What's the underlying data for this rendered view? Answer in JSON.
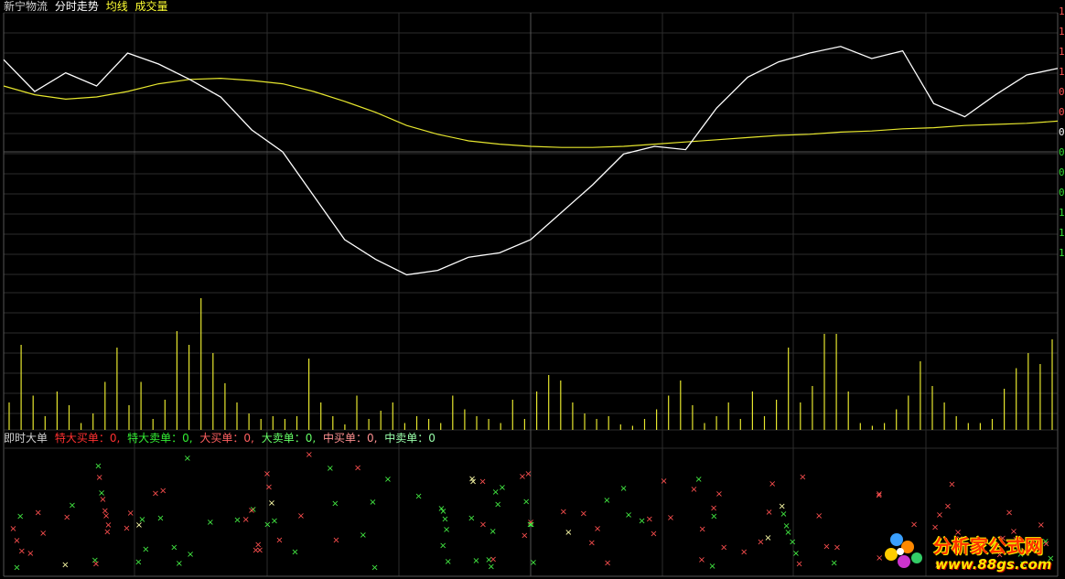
{
  "header": {
    "stock_name": "新宁物流",
    "view_title": "分时走势",
    "avg_label": "均线",
    "volume_label": "成交量"
  },
  "big_order_panel": {
    "title": "即时大单",
    "items": [
      {
        "label": "特大买单：0,",
        "color": "#ff3030"
      },
      {
        "label": "特大卖单：0,",
        "color": "#33ee33"
      },
      {
        "label": "大买单：0,",
        "color": "#ff6060"
      },
      {
        "label": "大卖单：0,",
        "color": "#66ff66"
      },
      {
        "label": "中买单：0,",
        "color": "#ff9090"
      },
      {
        "label": "中卖单：0",
        "color": "#99ffaa"
      }
    ]
  },
  "right_axis": {
    "labels": [
      "1",
      "1",
      "1",
      "1",
      "0",
      "0",
      "0",
      "0",
      "0",
      "0",
      "1",
      "1",
      "1"
    ],
    "label_colors": [
      "#ff5555",
      "#ff5555",
      "#ff5555",
      "#ff5555",
      "#ff5555",
      "#ff5555",
      "#ffffff",
      "#33dd33",
      "#33dd33",
      "#33dd33",
      "#33dd33",
      "#33dd33",
      "#33dd33"
    ]
  },
  "colors": {
    "price_line": "#ffffff",
    "avg_line": "#e6e62e",
    "volume_bar": "#e6e62e",
    "grid": "#2c2c2c",
    "buy_marker": "#ff5050",
    "sell_marker": "#44ee44",
    "big_marker": "#ffffaa"
  },
  "logo": {
    "text": "分析家公式网",
    "url": "www.88gs.com"
  },
  "chart_data": [
    {
      "type": "line",
      "title": "",
      "series": [
        {
          "name": "均线",
          "values": [
            0.6,
            0.52,
            0.48,
            0.5,
            0.55,
            0.62,
            0.66,
            0.67,
            0.65,
            0.62,
            0.55,
            0.46,
            0.36,
            0.24,
            0.16,
            0.1,
            0.07,
            0.05,
            0.04,
            0.04,
            0.05,
            0.07,
            0.09,
            0.11,
            0.13,
            0.15,
            0.16,
            0.18,
            0.19,
            0.21,
            0.22,
            0.24,
            0.25,
            0.26,
            0.28
          ]
        },
        {
          "name": "",
          "values": [
            0.84,
            0.55,
            0.72,
            0.6,
            0.9,
            0.8,
            0.66,
            0.5,
            0.2,
            0.0,
            -0.4,
            -0.8,
            -0.98,
            -1.12,
            -1.08,
            -0.96,
            -0.92,
            -0.8,
            -0.55,
            -0.3,
            -0.02,
            0.05,
            0.02,
            0.4,
            0.68,
            0.82,
            0.9,
            0.96,
            0.85,
            0.92,
            0.44,
            0.32,
            0.52,
            0.7,
            0.76
          ]
        }
      ]
    },
    {
      "type": "bar",
      "title": "",
      "values": [
        0.2,
        0.62,
        0.25,
        0.1,
        0.28,
        0.18,
        0.05,
        0.12,
        0.35,
        0.6,
        0.18,
        0.35,
        0.08,
        0.22,
        0.72,
        0.62,
        0.96,
        0.56,
        0.34,
        0.2,
        0.12,
        0.08,
        0.1,
        0.08,
        0.1,
        0.52,
        0.2,
        0.1,
        0.04,
        0.25,
        0.08,
        0.14,
        0.2,
        0.05,
        0.1,
        0.08,
        0.05,
        0.25,
        0.15,
        0.1,
        0.08,
        0.05,
        0.22,
        0.08,
        0.28,
        0.4,
        0.36,
        0.2,
        0.12,
        0.08,
        0.1,
        0.04,
        0.03,
        0.08,
        0.15,
        0.25,
        0.36,
        0.18,
        0.05,
        0.1,
        0.2,
        0.08,
        0.28,
        0.1,
        0.22,
        0.6,
        0.2,
        0.32,
        0.7,
        0.7,
        0.28,
        0.05,
        0.03,
        0.05,
        0.15,
        0.25,
        0.5,
        0.32,
        0.2,
        0.1,
        0.05,
        0.05,
        0.08,
        0.3,
        0.45,
        0.56,
        0.48,
        0.66
      ]
    }
  ]
}
